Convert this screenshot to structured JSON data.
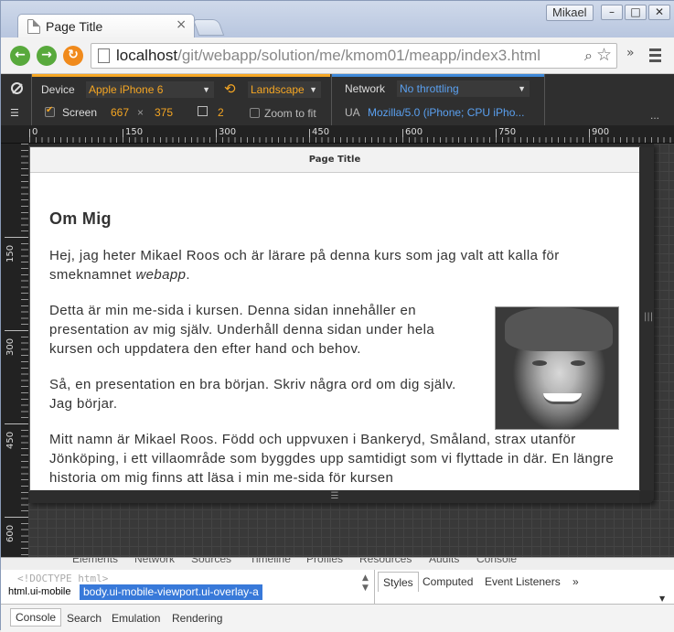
{
  "browser": {
    "tab_title": "Page Title",
    "tab_close": "×",
    "user": "Mikael",
    "win_min": "–",
    "win_max": "□",
    "win_close": "✕",
    "url_host": "localhost",
    "url_path": "/git/webapp/solution/me/kmom01/meapp/index3.html",
    "more": "»"
  },
  "emulation": {
    "device_label": "Device",
    "device_value": "Apple iPhone 6",
    "orientation": "Landscape",
    "screen_label": "Screen",
    "screen_width": "667",
    "times": "×",
    "screen_height": "375",
    "dpr": "2",
    "zoom_label": "Zoom to fit",
    "network_label": "Network",
    "network_value": "No throttling",
    "ua_label": "UA",
    "ua_value": "Mozilla/5.0 (iPhone; CPU iPho...",
    "more": "..."
  },
  "rulers": {
    "h": [
      "0",
      "150",
      "300",
      "450",
      "600",
      "750",
      "900"
    ],
    "v": [
      "150",
      "300",
      "450",
      "600"
    ]
  },
  "page": {
    "header": "Page Title",
    "heading": "Om Mig",
    "p1": "Hej, jag heter Mikael Roos och är lärare på denna kurs som jag valt att kalla för smeknamnet ",
    "p1_em": "webapp",
    "p1_end": ".",
    "p2": "Detta är min me-sida i kursen. Denna sidan innehåller en presentation av mig själv. Underhåll denna sidan under hela kursen och uppdatera den efter hand och behov.",
    "p3": "Så, en presentation en bra början. Skriv några ord om dig själv. Jag börjar.",
    "p4": "Mitt namn är Mikael Roos. Född och uppvuxen i Bankeryd, Småland, strax utanför Jönköping, i ett villaområde som byggdes upp samtidigt som vi flyttade in där. En längre historia om mig finns att läsa i min me-sida för kursen"
  },
  "devtools": {
    "tabs": [
      "Elements",
      "Network",
      "Sources",
      "Timeline",
      "Profiles",
      "Resources",
      "Audits",
      "Console"
    ],
    "doctype": "<!DOCTYPE html>",
    "crumb1": "html.ui-mobile",
    "crumb2": "body.ui-mobile-viewport.ui-overlay-a",
    "styles_tabs": [
      "Styles",
      "Computed",
      "Event Listeners"
    ],
    "styles_more": "»",
    "drawer_tabs": [
      "Console",
      "Search",
      "Emulation",
      "Rendering"
    ]
  },
  "colors": {
    "accent": "#f5a623",
    "network_accent": "#3e88d8",
    "selected_crumb": "#3879d9"
  }
}
